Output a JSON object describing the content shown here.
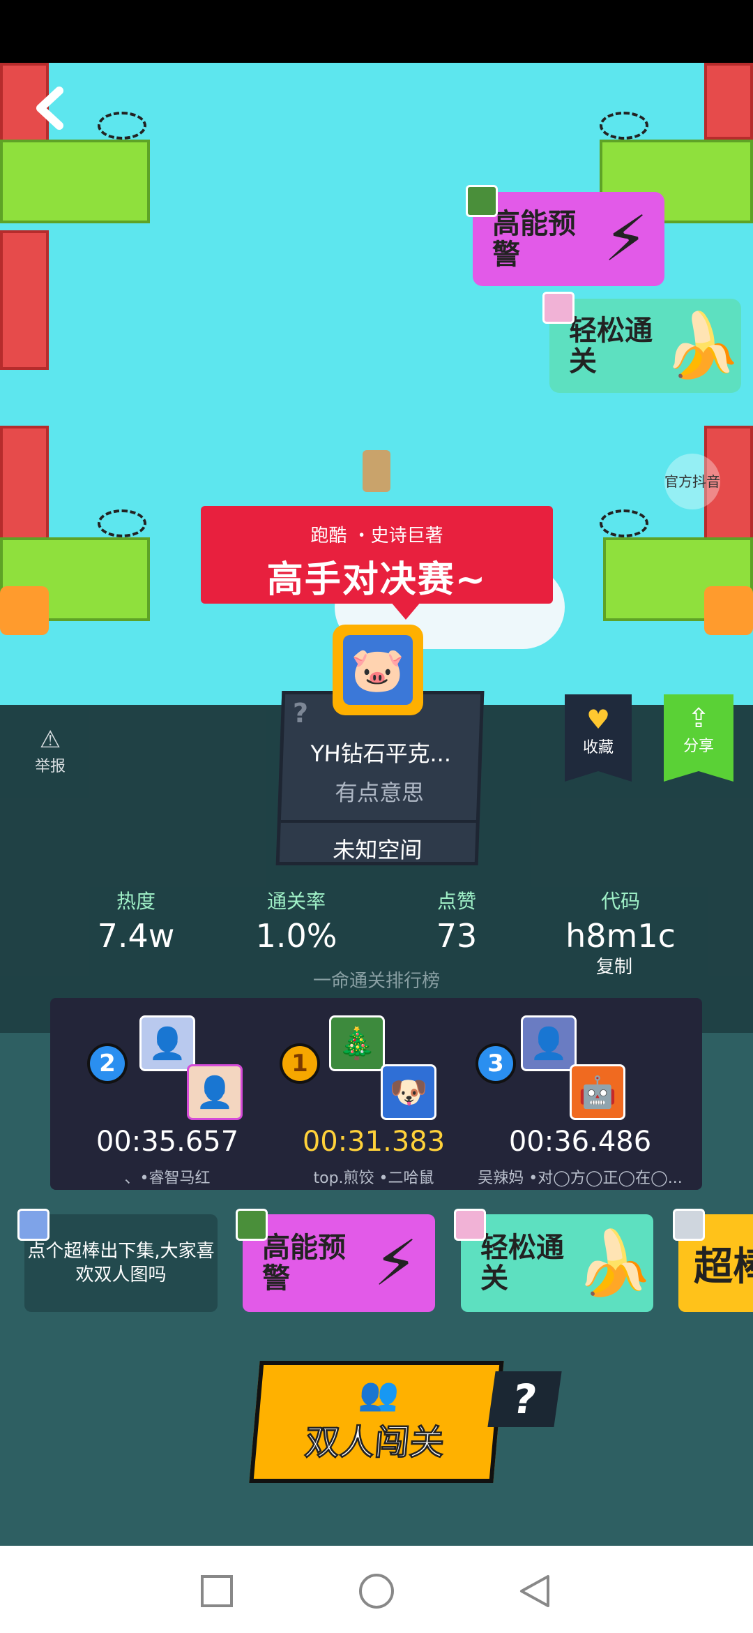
{
  "header": {
    "back_icon": "chevron-left-icon"
  },
  "side_tags": {
    "official_label": "官方抖音"
  },
  "banner": {
    "subtitle": "跑酷 ・史诗巨著",
    "title": "高手对决赛~"
  },
  "level_card": {
    "question_mark": "?",
    "name": "YH钻石平克...",
    "description": "有点意思",
    "space": "未知空间"
  },
  "actions": {
    "favorite_label": "收藏",
    "share_label": "分享",
    "report_label": "举报"
  },
  "stats": {
    "heat_label": "热度",
    "heat_value": "7.4w",
    "clear_rate_label": "通关率",
    "clear_rate_value": "1.0%",
    "likes_label": "点赞",
    "likes_value": "73",
    "code_label": "代码",
    "code_value": "h8m1c",
    "copy_label": "复制"
  },
  "ranking": {
    "title": "一命通关排行榜",
    "entries": [
      {
        "rank": "2",
        "time": "00:35.657",
        "names": "、•睿智马红"
      },
      {
        "rank": "1",
        "time": "00:31.383",
        "names": "top.煎饺 •二哈鼠"
      },
      {
        "rank": "3",
        "time": "00:36.486",
        "names": "吴辣妈 •对◯方◯正◯在◯..."
      }
    ]
  },
  "tags": {
    "high_energy": "高能预警",
    "easy_clear": "轻松通关",
    "super": "超棒",
    "comment": "点个超棒出下集,大家喜欢双人图吗"
  },
  "duo": {
    "label": "双人闯关",
    "help": "?"
  },
  "colors": {
    "banner": "#e8203e",
    "gold_time": "#ffd23a",
    "duo_button": "#ffb100",
    "high_energy_tag": "#e25ae8",
    "easy_tag": "#5de0c0"
  }
}
